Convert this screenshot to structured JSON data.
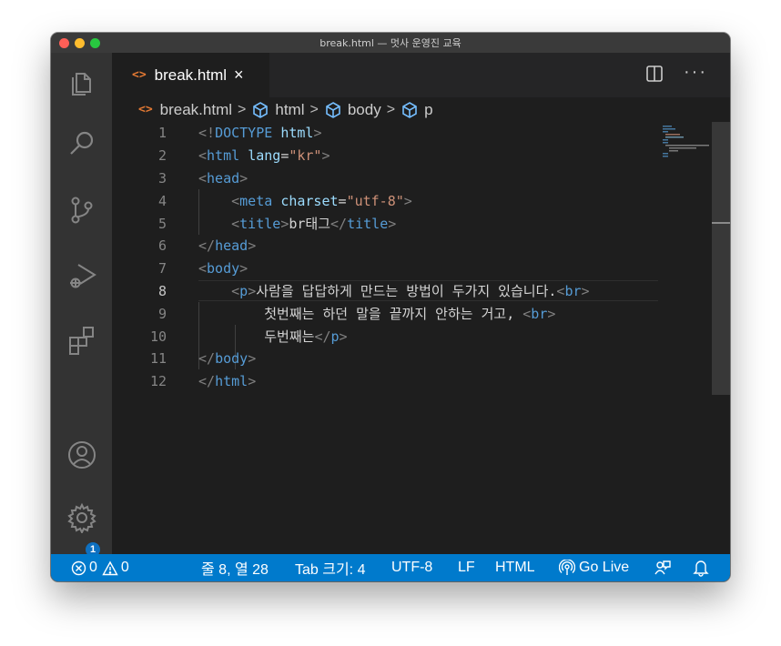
{
  "window": {
    "title": "break.html — 멋사 운영진 교육"
  },
  "tab": {
    "icon": "<>",
    "label": "break.html",
    "close": "×"
  },
  "editor_actions": {
    "more": "···"
  },
  "breadcrumb": {
    "file_icon": "<>",
    "file": "break.html",
    "sep": ">",
    "items": [
      "html",
      "body",
      "p"
    ]
  },
  "editor": {
    "current_line": 8,
    "line_numbers": [
      "1",
      "2",
      "3",
      "4",
      "5",
      "6",
      "7",
      "8",
      "9",
      "10",
      "11",
      "12"
    ],
    "lines": [
      [
        [
          "tg",
          "<!"
        ],
        [
          "tn",
          "DOCTYPE"
        ],
        [
          "tx",
          " "
        ],
        [
          "an",
          "html"
        ],
        [
          "tg",
          ">"
        ]
      ],
      [
        [
          "tg",
          "<"
        ],
        [
          "tn",
          "html"
        ],
        [
          "tx",
          " "
        ],
        [
          "an",
          "lang"
        ],
        [
          "tx",
          "="
        ],
        [
          "av",
          "\"kr\""
        ],
        [
          "tg",
          ">"
        ]
      ],
      [
        [
          "tg",
          "<"
        ],
        [
          "tn",
          "head"
        ],
        [
          "tg",
          ">"
        ]
      ],
      [
        [
          "tx",
          "    "
        ],
        [
          "tg",
          "<"
        ],
        [
          "tn",
          "meta"
        ],
        [
          "tx",
          " "
        ],
        [
          "an",
          "charset"
        ],
        [
          "tx",
          "="
        ],
        [
          "av",
          "\"utf-8\""
        ],
        [
          "tg",
          ">"
        ]
      ],
      [
        [
          "tx",
          "    "
        ],
        [
          "tg",
          "<"
        ],
        [
          "tn",
          "title"
        ],
        [
          "tg",
          ">"
        ],
        [
          "tx",
          "br태그"
        ],
        [
          "tg",
          "</"
        ],
        [
          "tn",
          "title"
        ],
        [
          "tg",
          ">"
        ]
      ],
      [
        [
          "tg",
          "</"
        ],
        [
          "tn",
          "head"
        ],
        [
          "tg",
          ">"
        ]
      ],
      [
        [
          "tg",
          "<"
        ],
        [
          "tn",
          "body"
        ],
        [
          "tg",
          ">"
        ]
      ],
      [
        [
          "tx",
          "    "
        ],
        [
          "tg",
          "<"
        ],
        [
          "tn",
          "p"
        ],
        [
          "tg",
          ">"
        ],
        [
          "tx",
          "사람을 답답하게 만드는 방법이 두가지 있습니다."
        ],
        [
          "tg",
          "<"
        ],
        [
          "tn",
          "br"
        ],
        [
          "tg",
          ">"
        ]
      ],
      [
        [
          "tx",
          "        첫번째는 하던 말을 끝까지 안하는 거고, "
        ],
        [
          "tg",
          "<"
        ],
        [
          "tn",
          "br"
        ],
        [
          "tg",
          ">"
        ]
      ],
      [
        [
          "tx",
          "        두번째는"
        ],
        [
          "tg",
          "</"
        ],
        [
          "tn",
          "p"
        ],
        [
          "tg",
          ">"
        ]
      ],
      [
        [
          "tg",
          "</"
        ],
        [
          "tn",
          "body"
        ],
        [
          "tg",
          ">"
        ]
      ],
      [
        [
          "tg",
          "</"
        ],
        [
          "tn",
          "html"
        ],
        [
          "tg",
          ">"
        ]
      ]
    ]
  },
  "activity_bar": {
    "icons": [
      "explorer-icon",
      "search-icon",
      "source-control-icon",
      "run-debug-icon",
      "extensions-icon",
      "account-icon",
      "settings-gear-icon"
    ],
    "badge": "1"
  },
  "statusbar": {
    "errors": "0",
    "warnings": "0",
    "position": "줄 8, 열 28",
    "tab_size": "Tab 크기: 4",
    "encoding": "UTF-8",
    "eol": "LF",
    "language": "HTML",
    "go_live": "Go Live"
  },
  "colors": {
    "statusbar": "#007acc",
    "editor_bg": "#1e1e1e",
    "activity_bg": "#333333",
    "tag": "#569cd6",
    "attribute": "#9cdcfe",
    "string": "#ce9178",
    "punctuation": "#808080",
    "file_icon": "#e37933"
  }
}
